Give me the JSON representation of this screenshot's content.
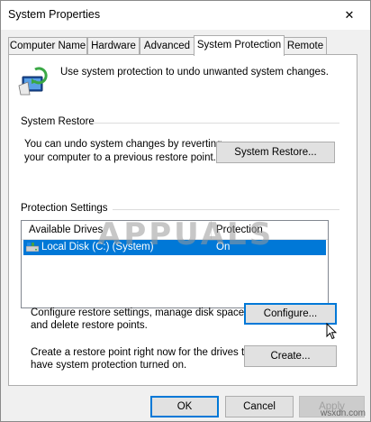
{
  "window": {
    "title": "System Properties",
    "close_glyph": "✕"
  },
  "tabs": [
    {
      "label": "Computer Name"
    },
    {
      "label": "Hardware"
    },
    {
      "label": "Advanced"
    },
    {
      "label": "System Protection",
      "active": true
    },
    {
      "label": "Remote"
    }
  ],
  "intro": {
    "text": "Use system protection to undo unwanted system changes.",
    "icon": "computer-shield-icon"
  },
  "system_restore": {
    "group_label": "System Restore",
    "description_line1": "You can undo system changes by reverting",
    "description_line2": "your computer to a previous restore point.",
    "button_label": "System Restore..."
  },
  "protection_settings": {
    "group_label": "Protection Settings",
    "columns": [
      "Available Drives",
      "Protection"
    ],
    "rows": [
      {
        "drive": "Local Disk (C:) (System)",
        "protection": "On",
        "selected": true,
        "icon": "drive-icon"
      }
    ],
    "configure_line1": "Configure restore settings, manage disk space,",
    "configure_line2": "and delete restore points.",
    "configure_button": "Configure...",
    "create_line1": "Create a restore point right now for the drives that",
    "create_line2": "have system protection turned on.",
    "create_button": "Create..."
  },
  "footer": {
    "ok": "OK",
    "cancel": "Cancel",
    "apply": "Apply"
  },
  "watermark": {
    "text": "APPUALS",
    "site": "wsxdn.com"
  },
  "colors": {
    "accent": "#0078d7",
    "selection": "#0078d7"
  }
}
